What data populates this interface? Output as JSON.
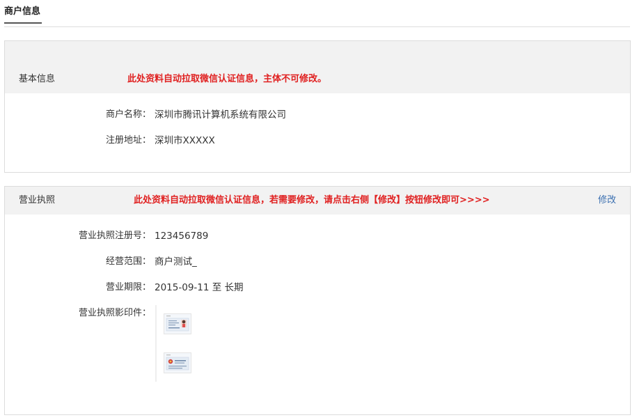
{
  "page": {
    "title": "商户信息"
  },
  "basic_info": {
    "title": "基本信息",
    "notice": "此处资料自动拉取微信认证信息，主体不可修改。",
    "fields": [
      {
        "label": "商户名称：",
        "value": "深圳市腾讯计算机系统有限公司"
      },
      {
        "label": "注册地址：",
        "value": "深圳市XXXXX"
      }
    ]
  },
  "license": {
    "title": "营业执照",
    "notice": "此处资料自动拉取微信认证信息，若需要修改，请点击右侧【修改】按钮修改即可>>>>",
    "edit_label": "修改",
    "fields": [
      {
        "label": "营业执照注册号：",
        "value": "123456789"
      },
      {
        "label": "经营范围：",
        "value": "商户测试_"
      },
      {
        "label": "营业期限：",
        "value": "2015-09-11 至 长期"
      }
    ],
    "copies_label": "营业执照影印件：",
    "copies": [
      {
        "icon": "id-card-front-icon",
        "accent": "#e05050"
      },
      {
        "icon": "id-card-back-icon",
        "accent": "#d04040"
      }
    ]
  },
  "colors": {
    "notice": "#e02020",
    "link": "#3a6fb0",
    "panel_header": "#f2f2f2",
    "border": "#dcdcdc"
  }
}
